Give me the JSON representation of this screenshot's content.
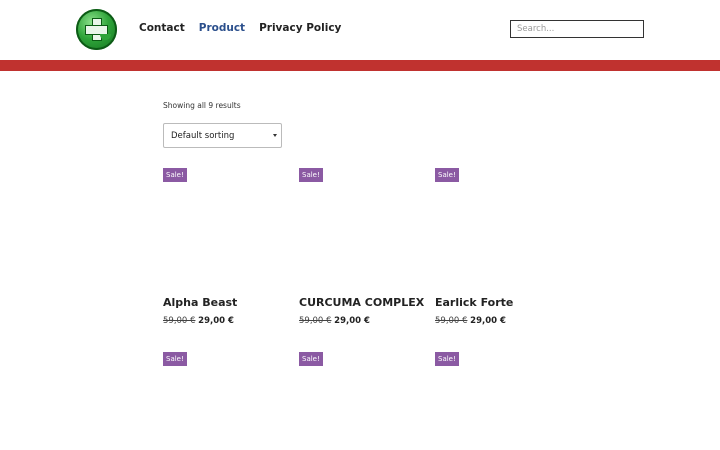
{
  "header": {
    "nav": [
      "Contact",
      "Product",
      "Privacy Policy"
    ],
    "active_nav": "Product",
    "search_placeholder": "Search..."
  },
  "shop": {
    "results_text": "Showing all 9 results",
    "sorting_value": "Default sorting"
  },
  "products": [
    {
      "sale": "Sale!",
      "name": "Alpha Beast",
      "old_price": "59,00 €",
      "price": "29,00 €"
    },
    {
      "sale": "Sale!",
      "name": "CURCUMA COMPLEX",
      "old_price": "59,00 €",
      "price": "29,00 €"
    },
    {
      "sale": "Sale!",
      "name": "Earlick Forte",
      "old_price": "59,00 €",
      "price": "29,00 €"
    },
    {
      "sale": "Sale!"
    },
    {
      "sale": "Sale!"
    },
    {
      "sale": "Sale!"
    }
  ],
  "colors": {
    "accent_bar": "#c0322f",
    "active_link": "#2b4f8c",
    "sale_badge": "#8b5aa3"
  }
}
